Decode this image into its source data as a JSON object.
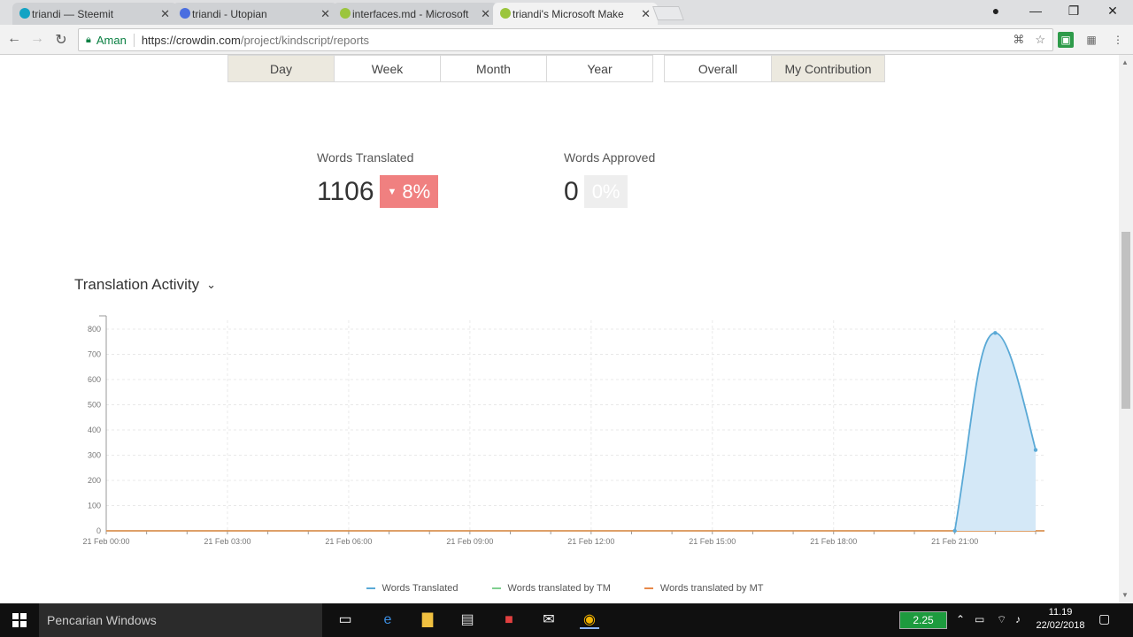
{
  "browser": {
    "tabs": [
      {
        "title": "triandi — Steemit",
        "favicon_color": "#12a3c4"
      },
      {
        "title": "triandi - Utopian",
        "favicon_color": "#4a6ee0"
      },
      {
        "title": "interfaces.md - Microsoft",
        "favicon_color": "#9bc53d"
      },
      {
        "title": "triandi's Microsoft Make",
        "favicon_color": "#9bc53d"
      }
    ],
    "close_glyph": "✕",
    "secure_label": "Aman",
    "url_host": "https://crowdin.com",
    "url_path": "/project/kindscript/reports"
  },
  "periods": [
    "Day",
    "Week",
    "Month",
    "Year"
  ],
  "scopes": [
    "Overall",
    "My Contribution"
  ],
  "stats": {
    "translated": {
      "label": "Words Translated",
      "value": "1106",
      "change": "8%"
    },
    "approved": {
      "label": "Words Approved",
      "value": "0",
      "change": "0%"
    }
  },
  "section_title": "Translation Activity",
  "chart_data": {
    "type": "area",
    "x_labels": [
      "21 Feb 00:00",
      "21 Feb 03:00",
      "21 Feb 06:00",
      "21 Feb 09:00",
      "21 Feb 12:00",
      "21 Feb 15:00",
      "21 Feb 18:00",
      "21 Feb 21:00"
    ],
    "y_ticks": [
      0,
      100,
      200,
      300,
      400,
      500,
      600,
      700,
      800
    ],
    "ylim": [
      0,
      800
    ],
    "xlim_hours": [
      0,
      23
    ],
    "series": [
      {
        "name": "Words Translated",
        "color": "#5aa9d6",
        "x_hours": [
          21,
          22,
          23
        ],
        "values": [
          0,
          785,
          321
        ]
      },
      {
        "name": "Words translated by TM",
        "color": "#7fcf8f",
        "x_hours": [
          0,
          23
        ],
        "values": [
          0,
          0
        ]
      },
      {
        "name": "Words translated by MT",
        "color": "#e8894a",
        "x_hours": [
          0,
          23
        ],
        "values": [
          0,
          0
        ]
      }
    ],
    "grid": true
  },
  "taskbar": {
    "search_placeholder": "Pencarian Windows",
    "battery_label": "2.25",
    "time": "11.19",
    "date": "22/02/2018"
  }
}
